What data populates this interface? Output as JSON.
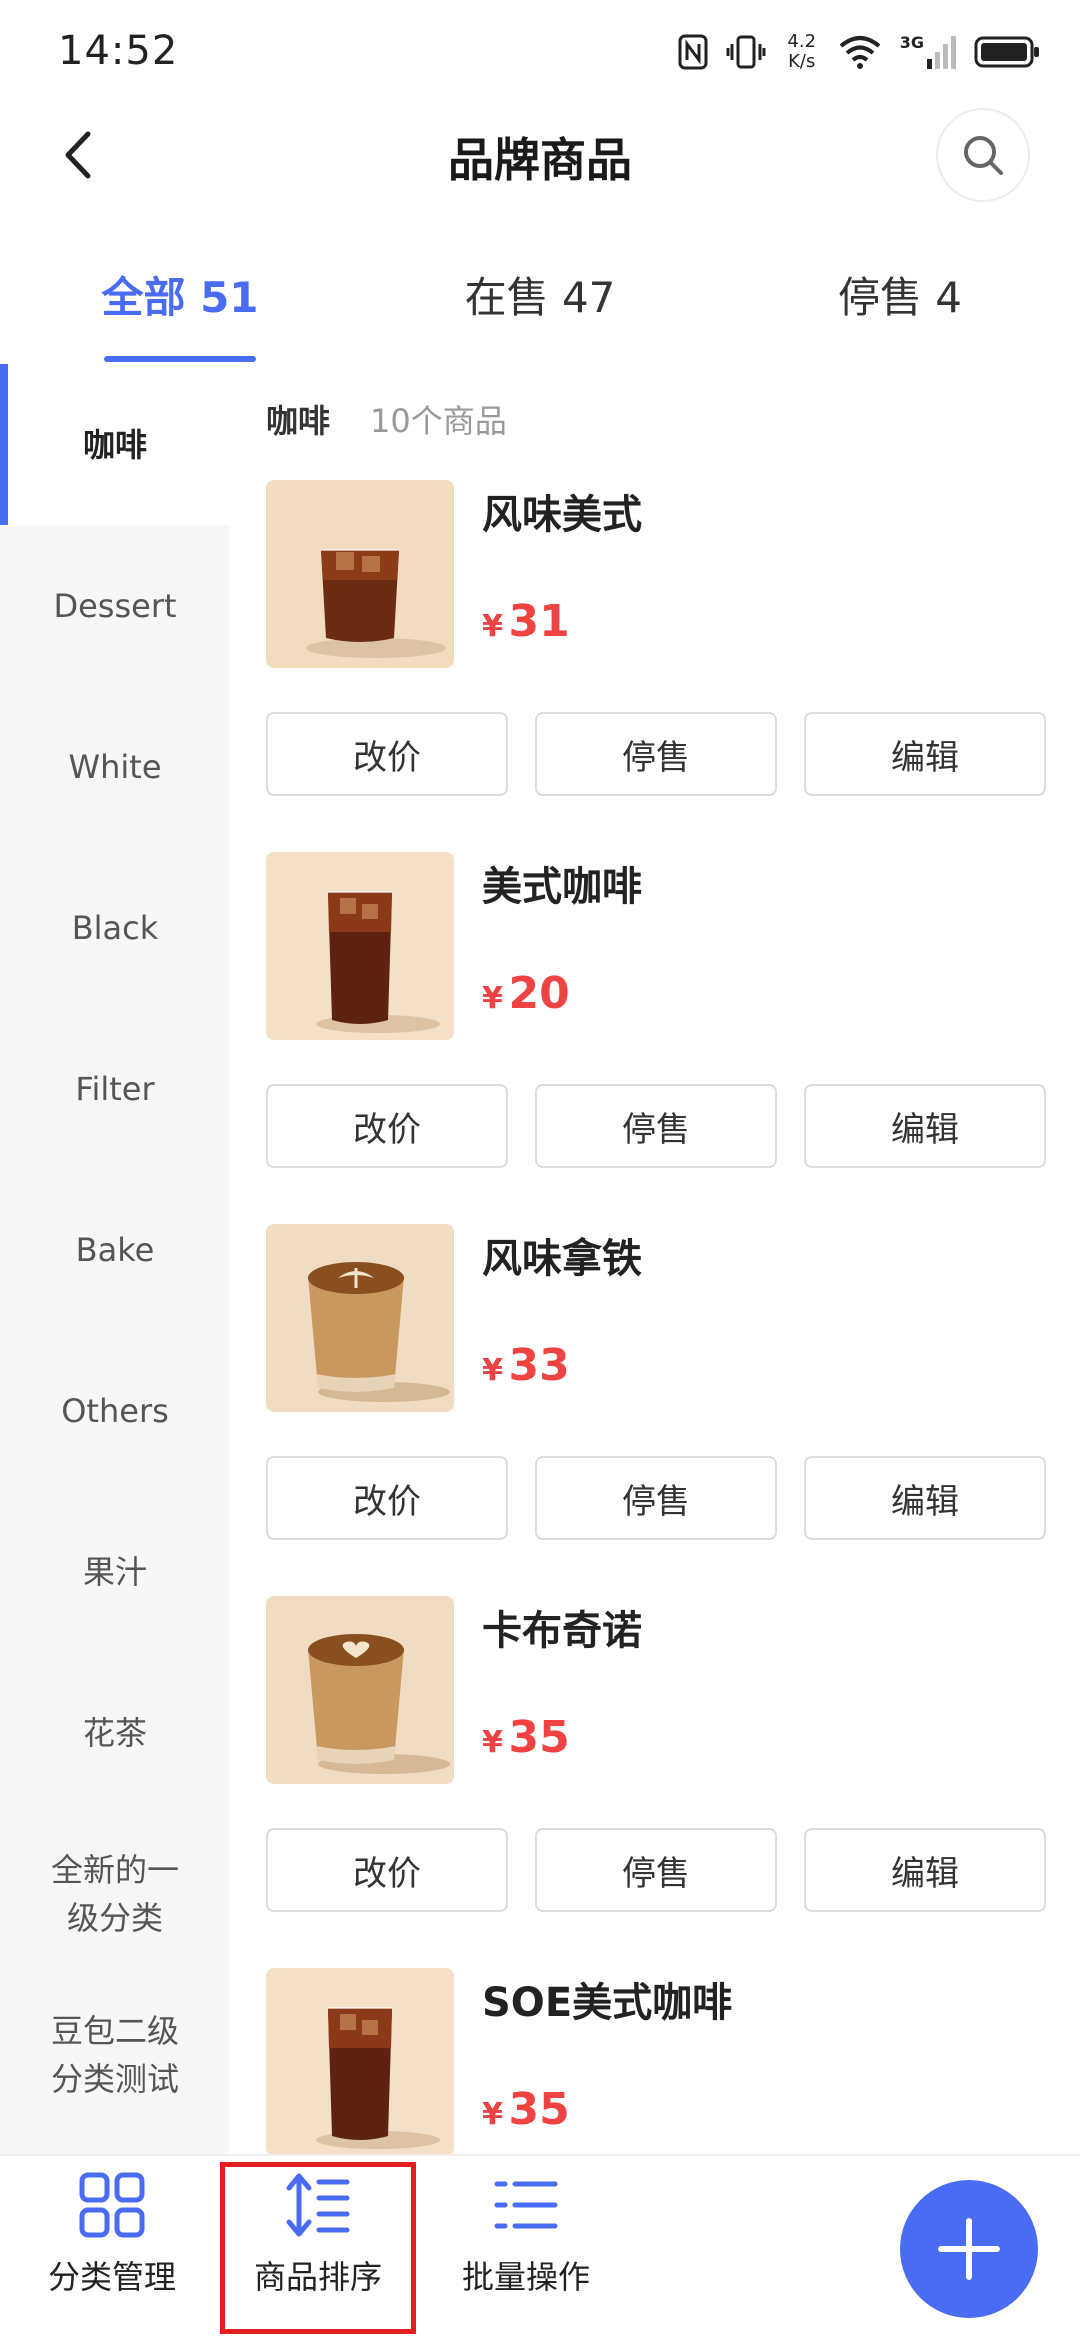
{
  "status_bar": {
    "time": "14:52",
    "net_speed_value": "4.2",
    "net_speed_unit": "K/s",
    "network_type": "3G"
  },
  "header": {
    "title": "品牌商品"
  },
  "tabs": [
    {
      "label": "全部 51",
      "active": true
    },
    {
      "label": "在售 47",
      "active": false
    },
    {
      "label": "停售 4",
      "active": false
    }
  ],
  "sidebar": {
    "items": [
      {
        "label": "咖啡",
        "active": true
      },
      {
        "label": "Dessert"
      },
      {
        "label": "White"
      },
      {
        "label": "Black"
      },
      {
        "label": "Filter"
      },
      {
        "label": "Bake"
      },
      {
        "label": "Others"
      },
      {
        "label": "果汁"
      },
      {
        "label": "花茶"
      },
      {
        "label": "全新的一级分类"
      },
      {
        "label": "豆包二级分类测试"
      }
    ]
  },
  "section": {
    "name": "咖啡",
    "count": "10个商品"
  },
  "currency": "¥",
  "actions": {
    "price": "改价",
    "stop": "停售",
    "edit": "编辑"
  },
  "products": [
    {
      "name": "风味美式",
      "price": "31",
      "image": "iced-americano-short-glass"
    },
    {
      "name": "美式咖啡",
      "price": "20",
      "image": "iced-americano-tall-glass"
    },
    {
      "name": "风味拿铁",
      "price": "33",
      "image": "latte-art-glass"
    },
    {
      "name": "卡布奇诺",
      "price": "35",
      "image": "cappuccino-glass"
    },
    {
      "name": "SOE美式咖啡",
      "price": "35",
      "image": "iced-americano-tall-glass"
    }
  ],
  "bottom_bar": {
    "category": "分类管理",
    "sort": "商品排序",
    "batch": "批量操作"
  },
  "colors": {
    "accent": "#4a6cf5",
    "price": "#ef4343",
    "highlight": "#e32020"
  }
}
